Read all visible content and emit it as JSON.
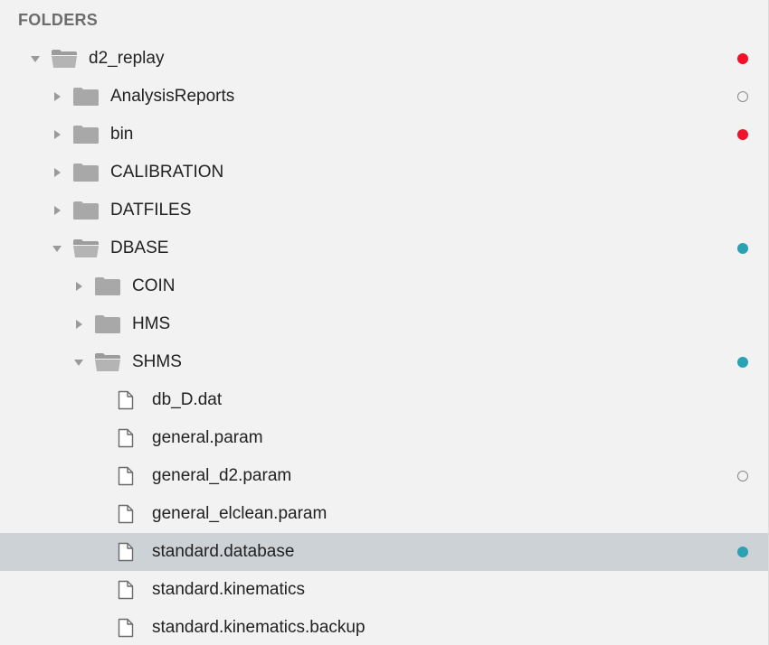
{
  "header": {
    "title": "FOLDERS"
  },
  "colors": {
    "status_red": "#f0112b",
    "status_teal": "#2aa2b3",
    "status_hollow": "#8a8a8a",
    "selected_row": "#cdd2d7",
    "folder_gray": "#a8a8a8"
  },
  "tree": [
    {
      "label": "d2_replay",
      "kind": "folder",
      "expanded": true,
      "status": "red",
      "icon": "folder-open-icon"
    },
    {
      "label": "AnalysisReports",
      "kind": "folder",
      "expanded": false,
      "status": "hollow",
      "icon": "folder-icon"
    },
    {
      "label": "bin",
      "kind": "folder",
      "expanded": false,
      "status": "red",
      "icon": "folder-icon"
    },
    {
      "label": "CALIBRATION",
      "kind": "folder",
      "expanded": false,
      "status": "none",
      "icon": "folder-icon"
    },
    {
      "label": "DATFILES",
      "kind": "folder",
      "expanded": false,
      "status": "none",
      "icon": "folder-icon"
    },
    {
      "label": "DBASE",
      "kind": "folder",
      "expanded": true,
      "status": "teal",
      "icon": "folder-open-icon"
    },
    {
      "label": "COIN",
      "kind": "folder",
      "expanded": false,
      "status": "none",
      "icon": "folder-icon"
    },
    {
      "label": "HMS",
      "kind": "folder",
      "expanded": false,
      "status": "none",
      "icon": "folder-icon"
    },
    {
      "label": "SHMS",
      "kind": "folder",
      "expanded": true,
      "status": "teal",
      "icon": "folder-open-icon"
    },
    {
      "label": "db_D.dat",
      "kind": "file",
      "status": "none",
      "icon": "file-icon"
    },
    {
      "label": "general.param",
      "kind": "file",
      "status": "none",
      "icon": "file-icon"
    },
    {
      "label": "general_d2.param",
      "kind": "file",
      "status": "hollow",
      "icon": "file-icon"
    },
    {
      "label": "general_elclean.param",
      "kind": "file",
      "status": "none",
      "icon": "file-icon"
    },
    {
      "label": "standard.database",
      "kind": "file",
      "status": "teal",
      "selected": true,
      "icon": "file-icon"
    },
    {
      "label": "standard.kinematics",
      "kind": "file",
      "status": "none",
      "icon": "file-icon"
    },
    {
      "label": "standard.kinematics.backup",
      "kind": "file",
      "status": "none",
      "icon": "file-icon"
    }
  ]
}
